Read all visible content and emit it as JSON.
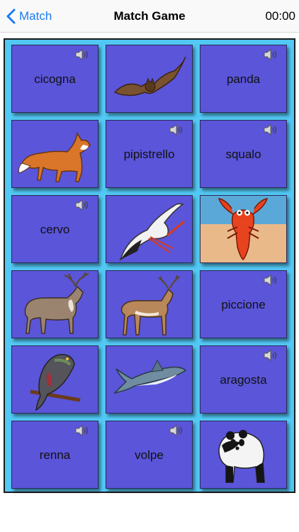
{
  "navbar": {
    "back_label": "Match",
    "title": "Match Game",
    "timer": "00:00"
  },
  "colors": {
    "accent": "#1a7cf5",
    "board": "#52c8f4",
    "card": "#5a55d9"
  },
  "cards": [
    {
      "type": "word",
      "text": "cicogna",
      "icon": "speaker-icon"
    },
    {
      "type": "image",
      "icon": "bat-image"
    },
    {
      "type": "word",
      "text": "panda",
      "icon": "speaker-icon"
    },
    {
      "type": "image",
      "icon": "fox-image"
    },
    {
      "type": "word",
      "text": "pipistrello",
      "icon": "speaker-icon"
    },
    {
      "type": "word",
      "text": "squalo",
      "icon": "speaker-icon"
    },
    {
      "type": "word",
      "text": "cervo",
      "icon": "speaker-icon"
    },
    {
      "type": "image",
      "icon": "stork-image"
    },
    {
      "type": "image",
      "icon": "lobster-image"
    },
    {
      "type": "image",
      "icon": "reindeer-image"
    },
    {
      "type": "image",
      "icon": "deer-image"
    },
    {
      "type": "word",
      "text": "piccione",
      "icon": "speaker-icon"
    },
    {
      "type": "image",
      "icon": "pigeon-image"
    },
    {
      "type": "image",
      "icon": "shark-image"
    },
    {
      "type": "word",
      "text": "aragosta",
      "icon": "speaker-icon"
    },
    {
      "type": "word",
      "text": "renna",
      "icon": "speaker-icon"
    },
    {
      "type": "word",
      "text": "volpe",
      "icon": "speaker-icon"
    },
    {
      "type": "image",
      "icon": "panda-image"
    }
  ]
}
